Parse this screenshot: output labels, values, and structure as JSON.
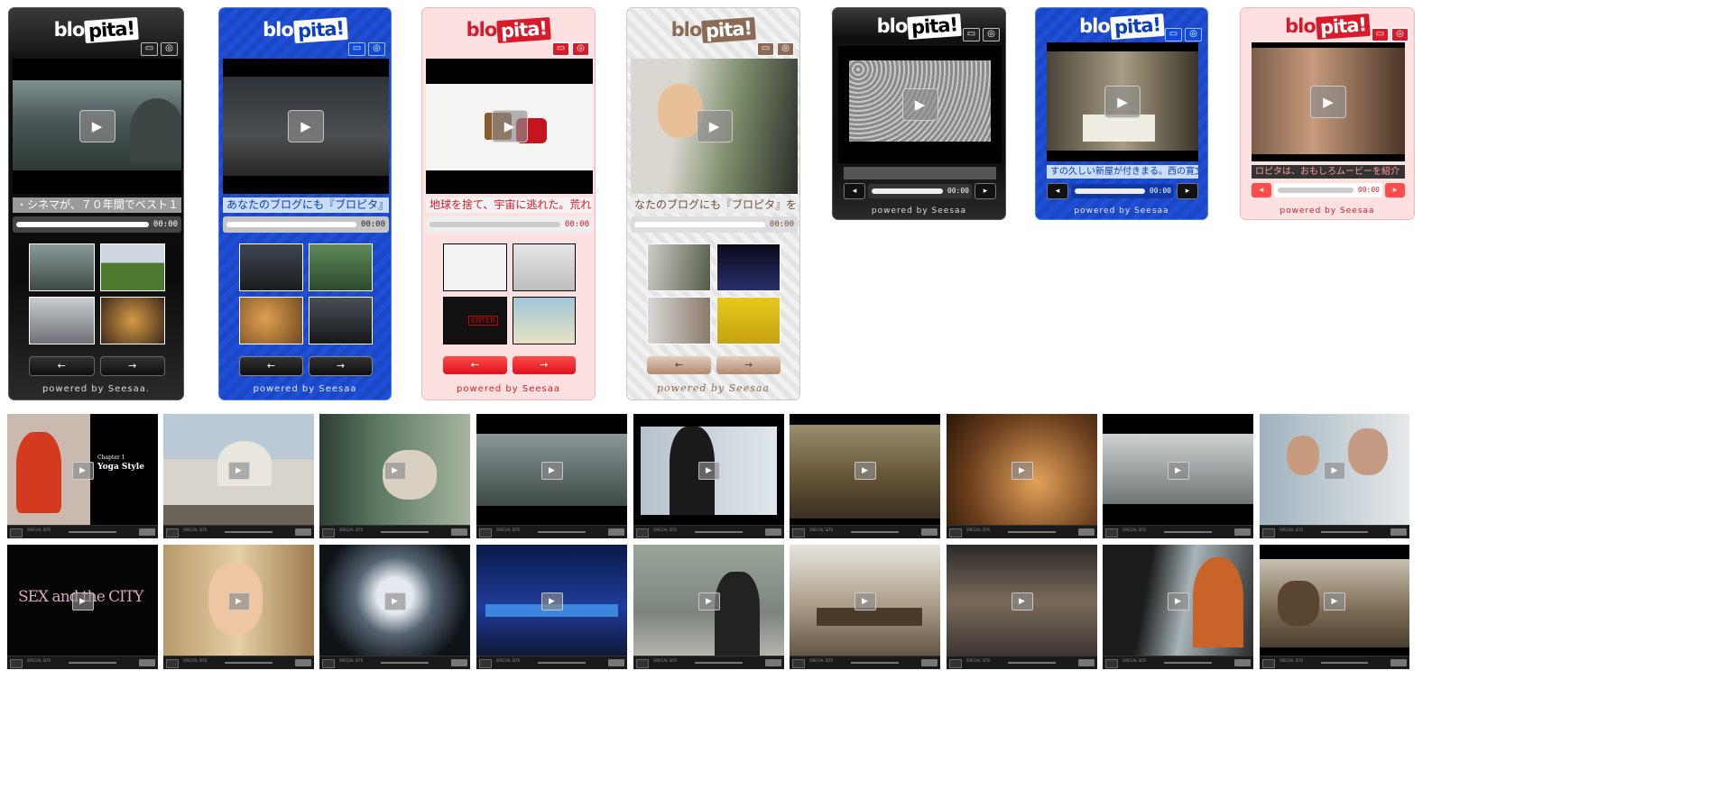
{
  "players": [
    {
      "theme": "black",
      "logo": "blo",
      "logo_box": "pita!",
      "title": "・シネマが、７０年間でベスト１",
      "time": "00:00",
      "prev": "←",
      "next": "→",
      "powered": "powered by Seesaa."
    },
    {
      "theme": "blue",
      "logo": "blo",
      "logo_box": "pita!",
      "title": "あなたのブログにも『ブロピタ』",
      "time": "00:00",
      "prev": "←",
      "next": "→",
      "powered": "powered by Seesaa"
    },
    {
      "theme": "pink",
      "logo": "blo",
      "logo_box": "pita!",
      "title": "地球を捨て、宇宙に逃れた。荒れ",
      "time": "00:00",
      "prev": "←",
      "next": "→",
      "powered": "powered by Seesaa"
    },
    {
      "theme": "pattern",
      "logo": "blo",
      "logo_box": "pita!",
      "title": "なたのブログにも『ブロピタ』を",
      "time": "00:00",
      "prev": "←",
      "next": "→",
      "powered": "powered by Seesaa"
    }
  ],
  "mini_players": [
    {
      "theme": "black",
      "logo": "blo",
      "logo_box": "pita!",
      "title": "",
      "time": "00:00",
      "powered": "powered by Seesaa"
    },
    {
      "theme": "blue",
      "logo": "blo",
      "logo_box": "pita!",
      "title": "すの久しい新屋が付きまる。西の寛文",
      "time": "00:00",
      "powered": "powered by Seesaa"
    },
    {
      "theme": "pink",
      "logo": "blo",
      "logo_box": "pita!",
      "title": "ロピタは、おもしろムービーを紹介",
      "time": "00:00",
      "powered": "powered by Seesaa"
    }
  ],
  "tiles_row1": [
    {
      "scene": "yoga",
      "caption1": "Chapter 1",
      "caption2": "Yoga Style"
    },
    {
      "scene": "observatory"
    },
    {
      "scene": "cat"
    },
    {
      "scene": "city"
    },
    {
      "scene": "woman"
    },
    {
      "scene": "tower"
    },
    {
      "scene": "hands"
    },
    {
      "scene": "sky"
    },
    {
      "scene": "doctors"
    }
  ],
  "tiles_row2": [
    {
      "scene": "sexcity",
      "caption1": "SEX and the CITY"
    },
    {
      "scene": "girl"
    },
    {
      "scene": "moon"
    },
    {
      "scene": "motel"
    },
    {
      "scene": "street"
    },
    {
      "scene": "boardroom"
    },
    {
      "scene": "crowd"
    },
    {
      "scene": "car"
    },
    {
      "scene": "deer"
    }
  ],
  "tile_controls": {
    "mini_text": "SPECIAL SITE",
    "time": "00:00"
  },
  "icons": {
    "play": "play-icon",
    "minimize": "minimize-icon",
    "fullscreen": "fullscreen-icon",
    "prev": "arrow-left-icon",
    "next": "arrow-right-icon"
  }
}
